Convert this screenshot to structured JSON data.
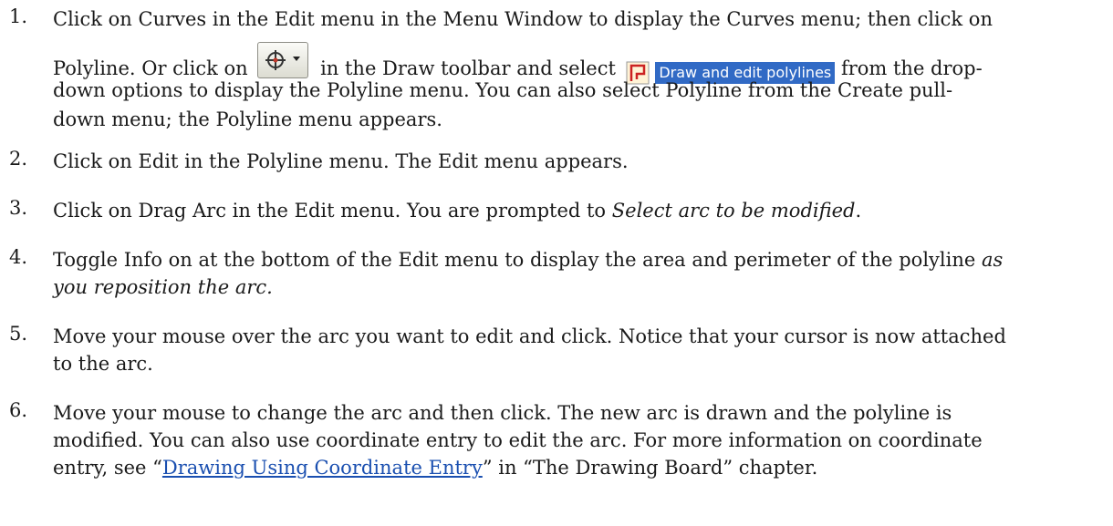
{
  "steps": [
    {
      "number": "1.",
      "a": "Click on Curves in the Edit menu in the Menu Window to display the Curves menu; then click on",
      "b": "Polyline. Or click on",
      "c": "in the Draw toolbar and select",
      "option_label": "Draw and edit polylines",
      "d": "from the drop-",
      "e": "down options to display the Polyline menu. You can also select Polyline from the Create pull-",
      "f": "down menu; the Polyline menu appears."
    },
    {
      "number": "2.",
      "text": "Click on Edit in the Polyline menu. The Edit menu appears."
    },
    {
      "number": "3.",
      "text": "Click on Drag Arc in the Edit menu. You are prompted to ",
      "italic": "Select arc to be modified",
      "tail": "."
    },
    {
      "number": "4.",
      "a": "Toggle Info on at the bottom of the Edit menu to display the area and perimeter of the polyline ",
      "a_italic": "as",
      "b_italic": "you reposition the arc."
    },
    {
      "number": "5.",
      "a": "Move your mouse over the arc you want to edit and click. Notice that your cursor is now attached",
      "b": "to the arc."
    },
    {
      "number": "6.",
      "a": "Move your mouse to change the arc and then click. The new arc is drawn and the polyline is",
      "b": "modified. You can also use coordinate entry to edit the arc. For more information on coordinate",
      "c": "entry, see “",
      "link": "Drawing Using Coordinate Entry",
      "d": "” in “The Drawing Board” chapter."
    }
  ],
  "icons": {
    "toolbar_button": "crosshair-circle-dropdown-icon",
    "option": "polyline-icon"
  },
  "colors": {
    "link": "#1a4fb0",
    "option_highlight": "#316ac5",
    "polyline_icon": "#cc2222"
  }
}
